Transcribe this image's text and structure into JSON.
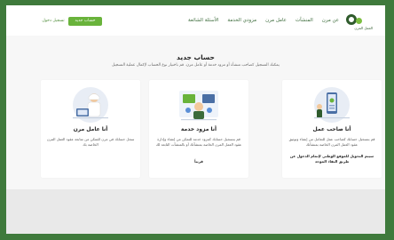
{
  "header": {
    "logo_text": "العمل المرن",
    "nav": [
      "عن مرن",
      "المنشآت",
      "عامل مرن",
      "مزودي الخدمة",
      "الأسئلة الشائعة"
    ],
    "new_account_label": "حساب جديد",
    "login_label": "تسجيل دخول"
  },
  "page": {
    "title": "حساب جديد",
    "subtitle": "يمكنك التسجيل كصاحب منشأة أو مزود خدمة أو عامل مرن. قم باختيار نوع الحساب لإكمال عملية التسجيل"
  },
  "cards": [
    {
      "title": "أنا صاحب عمل",
      "desc": "قم بتسجيل حسابك كصاحب عمل للتعامل من إنشاء وتوثيق عقود العمل المرن الخاصة بمنشأتك",
      "note": "سيتم التحويل للموقع الوطني لإتمام الدخول عن طريق النفاذ الموحد"
    },
    {
      "title": "أنا مزود خدمة",
      "desc": "قم بتسجيل حسابك كمزود خدمة للتمكن من إنشاء وإدارة عقود العمل المرن الخاصة بمنشآتك أو بالمنشآت التابعة لك",
      "note": "قريباً"
    },
    {
      "title": "أنا عامل مرن",
      "desc": "سجل حسابك في مرن للتمكن من متابعة عقود العمل المرن الخاصة بك",
      "note": ""
    }
  ],
  "colors": {
    "brand_green": "#69b33b",
    "dark_green": "#2f5b2c",
    "border_green": "#3f7a3c"
  }
}
